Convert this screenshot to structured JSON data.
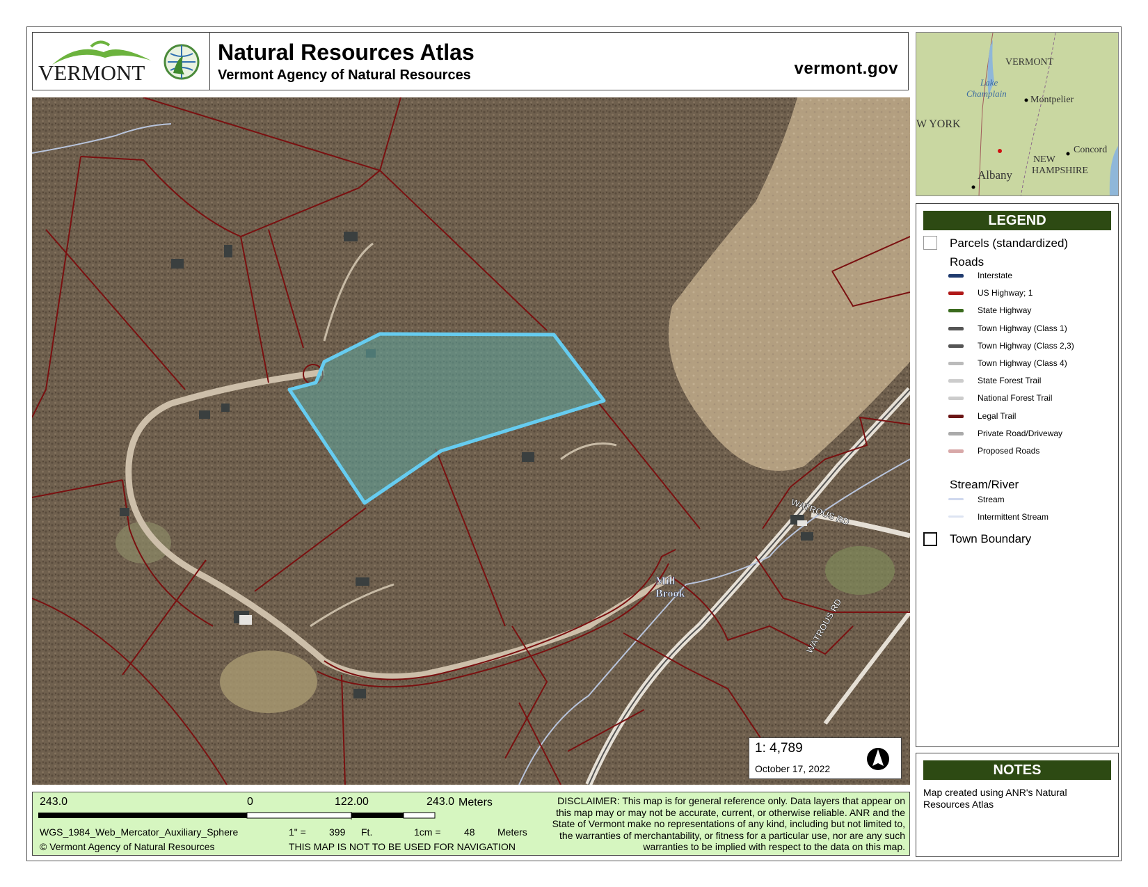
{
  "header": {
    "logo_text": "VERMONT",
    "title": "Natural Resources Atlas",
    "subtitle": "Vermont Agency of Natural Resources",
    "website": "vermont.gov"
  },
  "map": {
    "road_labels": [
      "WATROUS RD",
      "WATROUS RD"
    ],
    "stream_label": [
      "Mill",
      "Brook"
    ],
    "highlight_color": "#66ccf0",
    "parcel_line_color": "#7a1010"
  },
  "scale": {
    "ratio_prefix": "1:",
    "ratio": "4,789",
    "date": "October 17, 2022"
  },
  "inset": {
    "labels": [
      "VERMONT",
      "Lake",
      "Champlain",
      "Montpelier",
      "W YORK",
      "Albany",
      "NEW",
      "HAMPSHIRE",
      "Concord"
    ]
  },
  "legend": {
    "title": "LEGEND",
    "parcels": "Parcels (standardized)",
    "roads_heading": "Roads",
    "roads": [
      {
        "label": "Interstate",
        "color": "#1f3a6e"
      },
      {
        "label": "US Highway; 1",
        "color": "#b01818"
      },
      {
        "label": "State Highway",
        "color": "#3b6b1e"
      },
      {
        "label": "Town Highway (Class 1)",
        "color": "#555555"
      },
      {
        "label": "Town Highway (Class 2,3)",
        "color": "#555555"
      },
      {
        "label": "Town Highway (Class 4)",
        "color": "#bbbbbb"
      },
      {
        "label": "State Forest Trail",
        "color": "#cccccc"
      },
      {
        "label": "National Forest Trail",
        "color": "#cccccc"
      },
      {
        "label": "Legal Trail",
        "color": "#6b1515"
      },
      {
        "label": "Private Road/Driveway",
        "color": "#aaaaaa"
      },
      {
        "label": "Proposed Roads",
        "color": "#d8a8a8"
      }
    ],
    "stream_heading": "Stream/River",
    "streams": [
      {
        "label": "Stream",
        "color": "#cfd8ee"
      },
      {
        "label": "Intermittent Stream",
        "color": "#dde4f2"
      }
    ],
    "town_boundary": "Town Boundary"
  },
  "notes": {
    "title": "NOTES",
    "text": "Map created using ANR's Natural Resources Atlas"
  },
  "footer": {
    "scale_left": "243.0",
    "scale_zero": "0",
    "scale_mid": "122.00",
    "scale_right": "243.0",
    "scale_unit": "Meters",
    "projection": "WGS_1984_Web_Mercator_Auxiliary_Sphere",
    "inch_label": "1\" =",
    "inch_value": "399",
    "inch_unit": "Ft.",
    "cm_label": "1cm =",
    "cm_value": "48",
    "cm_unit": "Meters",
    "copyright": "© Vermont Agency of Natural Resources",
    "navigation_warning": "THIS MAP IS NOT TO BE USED FOR NAVIGATION",
    "disclaimer": "DISCLAIMER: This map is for general reference only. Data layers that appear on this map may or may not be accurate, current, or otherwise reliable. ANR and the State of Vermont make no representations of any kind, including but not limited to, the warranties of merchantability, or fitness for a particular use, nor are any such warranties to be implied with respect to the data on this map."
  }
}
